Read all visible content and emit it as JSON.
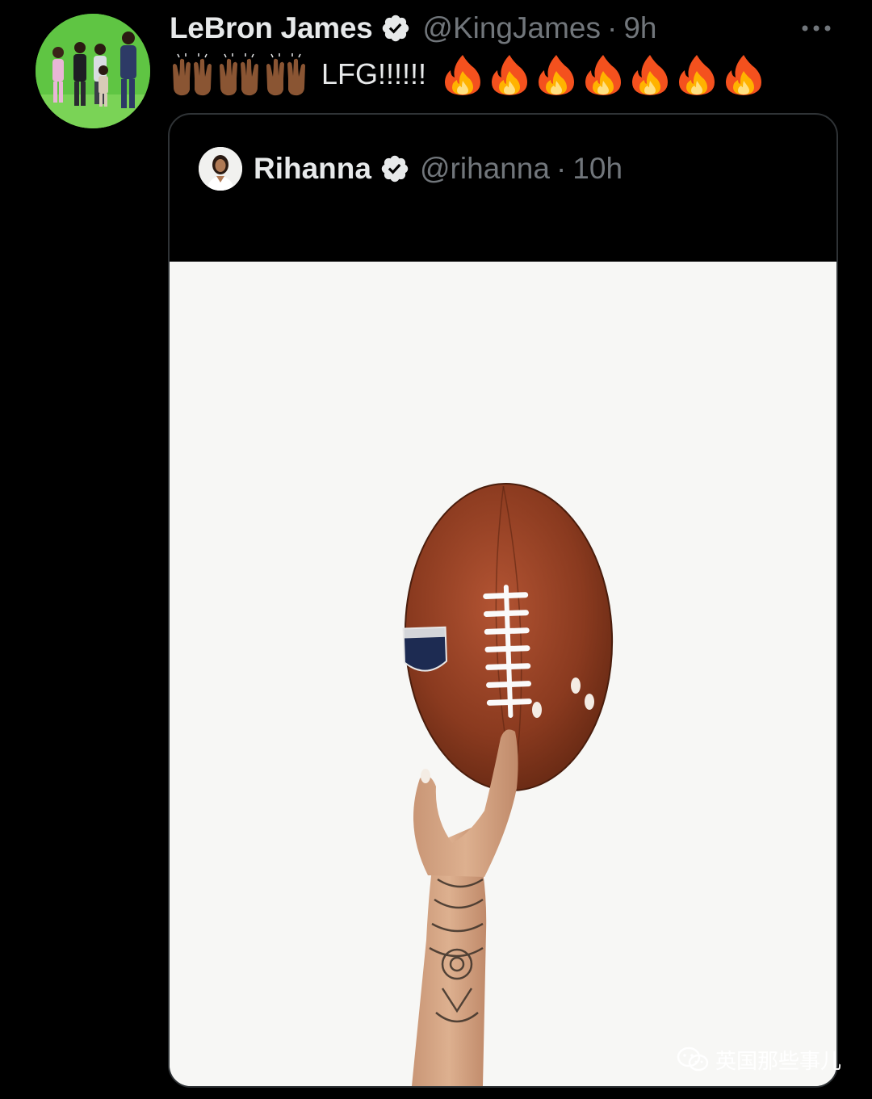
{
  "tweet": {
    "author": {
      "name": "LeBron James",
      "handle": "@KingJames",
      "time": "9h",
      "avatar_icon": "profile-photo-green-screen",
      "verified_icon": "verified-badge-icon"
    },
    "text": "LFG!!!!!!",
    "emoji_icons": {
      "raising_hands": "raising-hands-medium-dark-skin-icon",
      "raising_hands_count": 3,
      "fire": "fire-icon",
      "fire_count": 7
    },
    "separator": "·",
    "more_icon": "more-options-icon"
  },
  "quote": {
    "author": {
      "name": "Rihanna",
      "handle": "@rihanna",
      "time": "10h",
      "avatar_icon": "profile-photo-portrait"
    },
    "text": ".",
    "media": {
      "alt_subject": "hand-holding-nfl-football-photo"
    }
  },
  "watermark": {
    "text": "英国那些事儿",
    "icon": "wechat-icon"
  },
  "colors": {
    "background": "#000000",
    "primary_text": "#e7e9ea",
    "secondary_text": "#71767b",
    "border": "#2f3336",
    "photo_background": "#f7f7f5",
    "football": "#8a3a1f"
  }
}
